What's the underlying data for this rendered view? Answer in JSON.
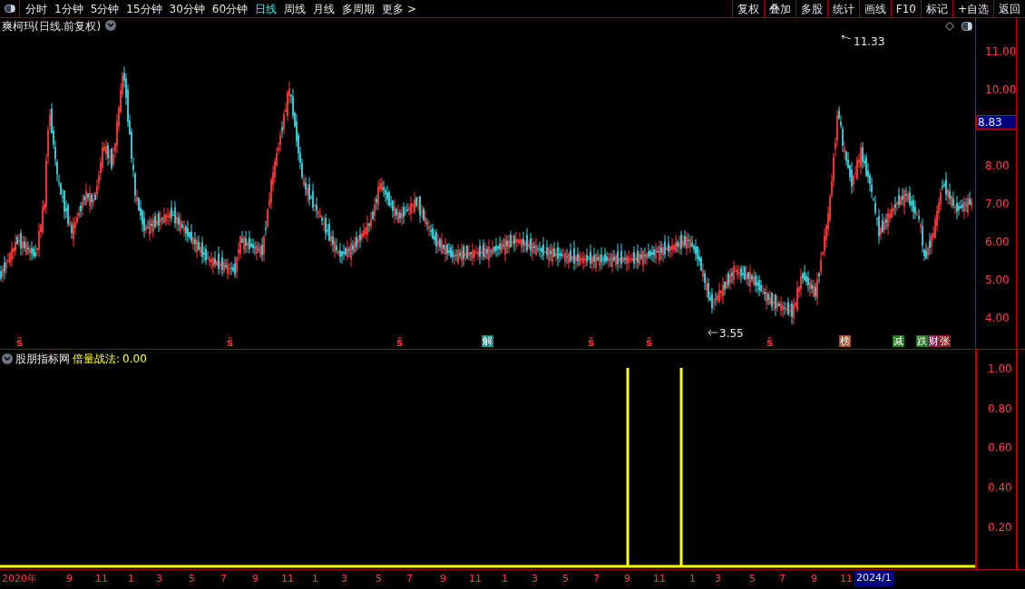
{
  "toolbar": {
    "periods": [
      {
        "label": "分时",
        "selected": false
      },
      {
        "label": "1分钟",
        "selected": false
      },
      {
        "label": "5分钟",
        "selected": false
      },
      {
        "label": "15分钟",
        "selected": false
      },
      {
        "label": "30分钟",
        "selected": false
      },
      {
        "label": "60分钟",
        "selected": false
      },
      {
        "label": "日线",
        "selected": true
      },
      {
        "label": "周线",
        "selected": false
      },
      {
        "label": "月线",
        "selected": false
      },
      {
        "label": "多周期",
        "selected": false
      },
      {
        "label": "更多 >",
        "selected": false
      }
    ],
    "actions": [
      "复权",
      "叠加",
      "多股",
      "统计",
      "画线",
      "F10",
      "标记",
      "+自选",
      "返回"
    ]
  },
  "main_chart": {
    "title": "爽柯玛(日线.前复权)",
    "price_axis": [
      "11.00",
      "10.00",
      "8.00",
      "7.00",
      "6.00",
      "5.00",
      "4.00"
    ],
    "current_price": "8.83",
    "high_label": "11.33",
    "low_label": "3.55",
    "events": [
      {
        "label": "ŝ",
        "kind": "mark",
        "color": "#ff3030"
      },
      {
        "label": "ŝ",
        "kind": "mark",
        "color": "#ff3030"
      },
      {
        "label": "ŝ",
        "kind": "mark",
        "color": "#ff3030"
      },
      {
        "label": "解",
        "kind": "tag",
        "color": "#1a8a8a"
      },
      {
        "label": "ŝ",
        "kind": "mark",
        "color": "#ff3030"
      },
      {
        "label": "ŝ",
        "kind": "mark",
        "color": "#ff3030"
      },
      {
        "label": "ŝ",
        "kind": "mark",
        "color": "#ff3030"
      },
      {
        "label": "榜",
        "kind": "tag",
        "color": "#a0522d"
      },
      {
        "label": "减",
        "kind": "tag",
        "color": "#1f7a1f"
      },
      {
        "label": "跌",
        "kind": "tag",
        "color": "#1f7a1f"
      },
      {
        "label": "财",
        "kind": "tag",
        "color": "#8a1f5a"
      },
      {
        "label": "张",
        "kind": "tag",
        "color": "#8a1f1f"
      }
    ]
  },
  "indicator": {
    "name": "股朋指标网",
    "formula_label": "倍量战法:",
    "value": "0.00",
    "axis": [
      "1.00",
      "0.80",
      "0.60",
      "0.40",
      "0.20"
    ]
  },
  "time_axis": {
    "labels": [
      "2020年",
      "9",
      "11",
      "1",
      "3",
      "5",
      "7",
      "9",
      "11",
      "1",
      "3",
      "5",
      "7",
      "9",
      "11",
      "1",
      "3",
      "5",
      "7",
      "9",
      "11",
      "1",
      "3",
      "5",
      "7",
      "9",
      "11"
    ],
    "current": "2024/1"
  }
}
